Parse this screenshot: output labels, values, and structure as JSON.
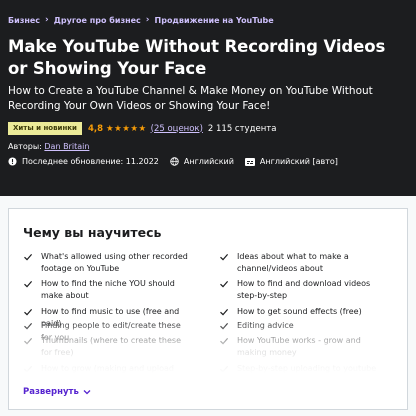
{
  "breadcrumb": [
    "Бизнес",
    "Другое про бизнес",
    "Продвижение на YouTube"
  ],
  "course": {
    "title": "Make YouTube Without Recording Videos or Showing Your Face",
    "subtitle": "How to Create a YouTube Channel & Make Money on YouTube Without Recording Your Own Videos or Showing Your Face!",
    "badge": "Хиты и новинки",
    "rating": "4,8",
    "stars": "★★★★★",
    "rating_count": "(25 оценок)",
    "students": "2 115 студента",
    "author_label": "Авторы:",
    "author_name": "Dan Britain",
    "last_updated": "Последнее обновление: 11.2022",
    "language": "Английский",
    "captions": "Английский [авто]"
  },
  "learn": {
    "title": "Чему вы научитесь",
    "left": [
      "What's allowed using other recorded footage on YouTube",
      "How to find the niche YOU should make about",
      "How to find music to use (free and paid)",
      "Finding people to edit/create these for you",
      "Thumbnails (where to create these for free)",
      "How to grow (making and upload schedule"
    ],
    "right": [
      "Ideas about what to make a channel/videos about",
      "How to find and download videos step-by-step",
      "How to get sound effects (free)",
      "Editing advice",
      "How YouTube works - grow and making money",
      "Step-by-step uploading to youtube"
    ],
    "expand_label": "Развернуть"
  },
  "colors": {
    "hero_bg": "#1c1d1f",
    "link": "#cec0fc",
    "star": "#f69c08",
    "badge_bg": "#eceb98",
    "accent": "#5624d0"
  }
}
